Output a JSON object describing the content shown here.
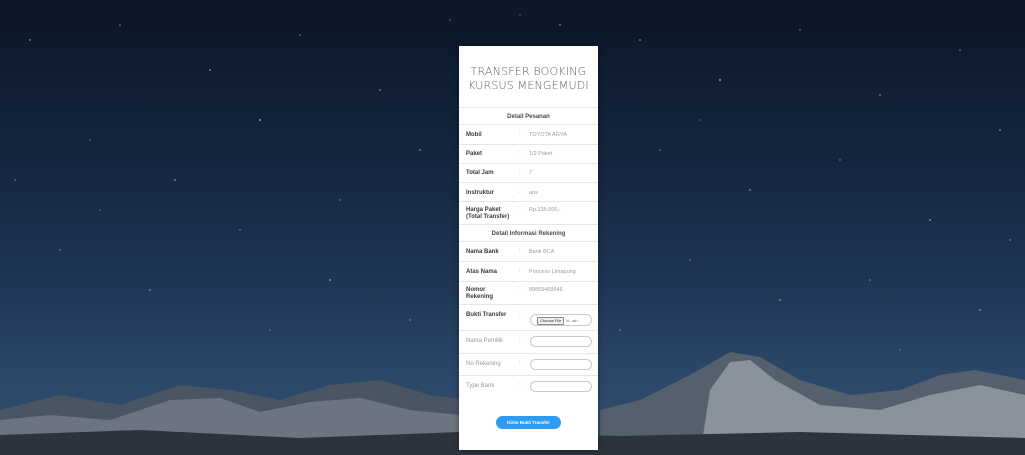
{
  "title": {
    "line1": "TRANSFER BOOKING",
    "line2": "KURSUS MENGEMUDI"
  },
  "order_section": {
    "heading": "Detail Pesanan",
    "rows": [
      {
        "label": "Mobil",
        "value": "TOYOTA AGYA"
      },
      {
        "label": "Paket",
        "value": "1/2 Paket"
      },
      {
        "label": "Total Jam",
        "value": "7"
      },
      {
        "label": "Instruktur",
        "value": "aris"
      },
      {
        "label": "Harga Paket (Total Transfer)",
        "label_line1": "Harga Paket",
        "label_line2": "(Total Transfer)",
        "value": "Rp.135.000,-"
      }
    ]
  },
  "account_section": {
    "heading": "Detail Informasi Rekening",
    "rows": [
      {
        "label": "Nama Bank",
        "value": "Bank BCA"
      },
      {
        "label": "Atas Nama",
        "value": "Princess Limapung"
      },
      {
        "label": "Nomor Rekening",
        "label_line1": "Nomor",
        "label_line2": "Rekening",
        "value": "89859469546"
      }
    ]
  },
  "form": {
    "bukti_transfer_label": "Bukti Transfer",
    "choose_file_label": "Choose File",
    "file_name": "N...ain",
    "nama_pemilik_label": "Nama Pemilik",
    "no_rekening_label": "No Rekening",
    "type_bank_label": "Type Bank",
    "submit_label": "Kirim Bukti Transfer"
  },
  "colon": ":",
  "colors": {
    "submit": "#2f9bf0",
    "card": "#ffffff"
  }
}
